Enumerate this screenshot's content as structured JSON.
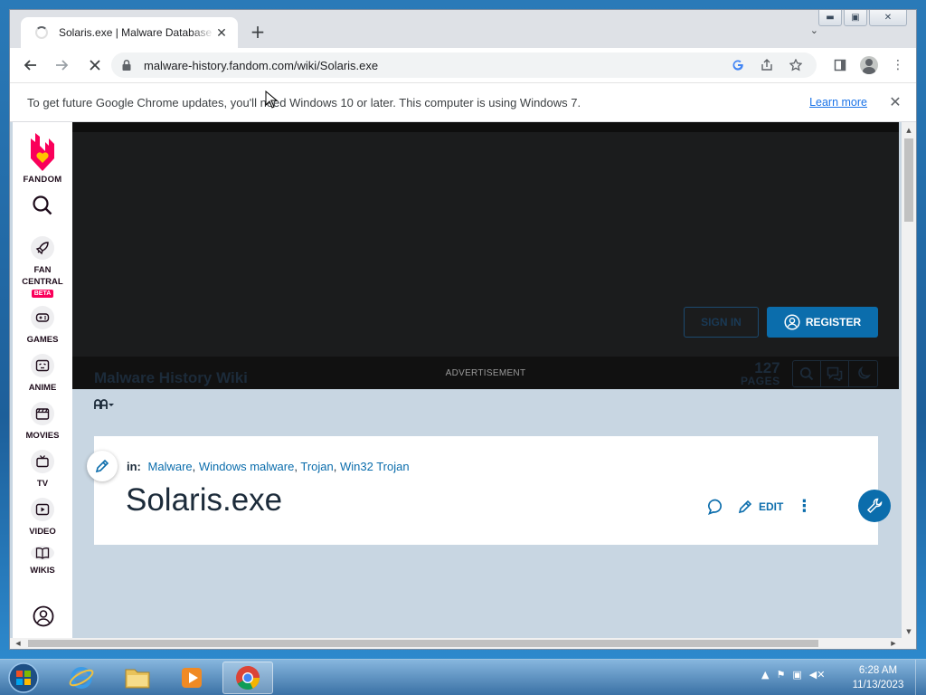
{
  "browser": {
    "tab_title": "Solaris.exe | Malware Database Wiki",
    "url": "malware-history.fandom.com/wiki/Solaris.exe",
    "infobar_message": "To get future Google Chrome updates, you'll need Windows 10 or later. This computer is using Windows 7.",
    "infobar_link": "Learn more"
  },
  "fandom_sidebar": {
    "logo_label": "FANDOM",
    "items": [
      {
        "label": "FAN CENTRAL",
        "badge": "BETA",
        "icon": "rocket-icon"
      },
      {
        "label": "GAMES",
        "icon": "gamepad-icon"
      },
      {
        "label": "ANIME",
        "icon": "anime-face-icon"
      },
      {
        "label": "MOVIES",
        "icon": "clapperboard-icon"
      },
      {
        "label": "TV",
        "icon": "tv-icon"
      },
      {
        "label": "VIDEO",
        "icon": "video-icon"
      },
      {
        "label": "WIKIS",
        "icon": "book-icon"
      }
    ]
  },
  "ad": {
    "label": "ADVERTISEMENT"
  },
  "wiki": {
    "sign_in": "SIGN IN",
    "register": "REGISTER",
    "title": "Malware History Wiki",
    "pages_count": "127",
    "pages_label": "PAGES"
  },
  "article": {
    "in_label": "in:",
    "categories": [
      "Malware",
      "Windows malware",
      "Trojan",
      "Win32 Trojan"
    ],
    "title": "Solaris.exe",
    "edit_label": "EDIT"
  },
  "taskbar": {
    "time": "6:28 AM",
    "date": "11/13/2023"
  },
  "colors": {
    "fandom_blue": "#0b6dac",
    "page_bg": "#c8d6e2",
    "fandom_pink": "#fa005a"
  }
}
